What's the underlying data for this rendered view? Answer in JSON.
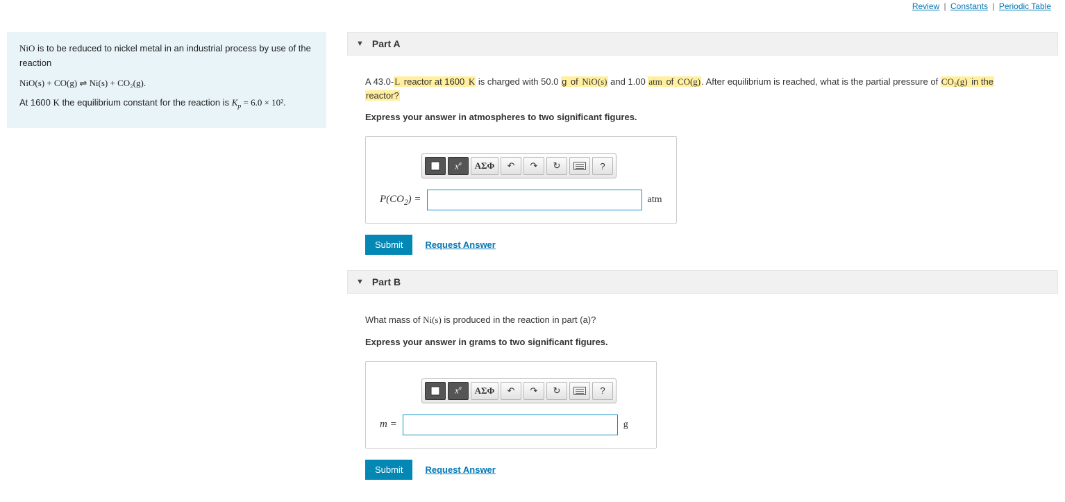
{
  "topLinks": {
    "review": "Review",
    "constants": "Constants",
    "periodic": "Periodic Table"
  },
  "intro": {
    "line1_before": "NiO",
    "line1_mid": " is to be reduced to nickel metal in an industrial process by use of the reaction",
    "equation": "NiO(s) + CO(g)  ⇌  Ni(s) + CO₂(g).",
    "line2_a": "At 1600 ",
    "line2_k": "K",
    "line2_b": " the equilibrium constant for the reaction is ",
    "kp_label": "K",
    "kp_sub": "p",
    "kp_val": " = 6.0 × 10²."
  },
  "parts": [
    {
      "title": "Part A",
      "question_segments": [
        {
          "t": "A 43.0-",
          "hl": false,
          "serif": false
        },
        {
          "t": "L",
          "hl": true,
          "serif": true
        },
        {
          "t": " reactor at 1600 ",
          "hl": true,
          "serif": false
        },
        {
          "t": "K",
          "hl": true,
          "serif": true
        },
        {
          "t": " is charged with 50.0 ",
          "hl": false,
          "serif": false
        },
        {
          "t": "g",
          "hl": true,
          "serif": false
        },
        {
          "t": " of ",
          "hl": true,
          "serif": false
        },
        {
          "t": "NiO(s)",
          "hl": true,
          "serif": true
        },
        {
          "t": " and 1.00 ",
          "hl": false,
          "serif": false
        },
        {
          "t": "atm",
          "hl": true,
          "serif": true
        },
        {
          "t": " of ",
          "hl": true,
          "serif": false
        },
        {
          "t": "CO(g)",
          "hl": true,
          "serif": true
        },
        {
          "t": ". After equilibrium is reached, what is the partial pressure of ",
          "hl": false,
          "serif": false
        },
        {
          "t": "CO₂(g)",
          "hl": true,
          "serif": true
        },
        {
          "t": " in the",
          "hl": true,
          "serif": false
        },
        {
          "br": true
        },
        {
          "t": "reactor?",
          "hl": true,
          "serif": false
        }
      ],
      "express": "Express your answer in atmospheres to two significant figures.",
      "entry_label_html": "P(CO₂) =",
      "entry_unit": "atm",
      "submit": "Submit",
      "request": "Request Answer"
    },
    {
      "title": "Part B",
      "question_segments": [
        {
          "t": "What mass of ",
          "hl": false,
          "serif": false
        },
        {
          "t": "Ni(s)",
          "hl": false,
          "serif": true
        },
        {
          "t": " is produced in the reaction in part (a)?",
          "hl": false,
          "serif": false
        }
      ],
      "express": "Express your answer in grams to two significant figures.",
      "entry_label_html": "m =",
      "entry_unit": "g",
      "submit": "Submit",
      "request": "Request Answer"
    }
  ],
  "toolbar": {
    "template": "template-btn",
    "sqrt": "√x",
    "greek": "ΑΣΦ",
    "undo": "↶",
    "redo": "↷",
    "reset": "↻",
    "keyboard": "keyboard",
    "help": "?"
  }
}
